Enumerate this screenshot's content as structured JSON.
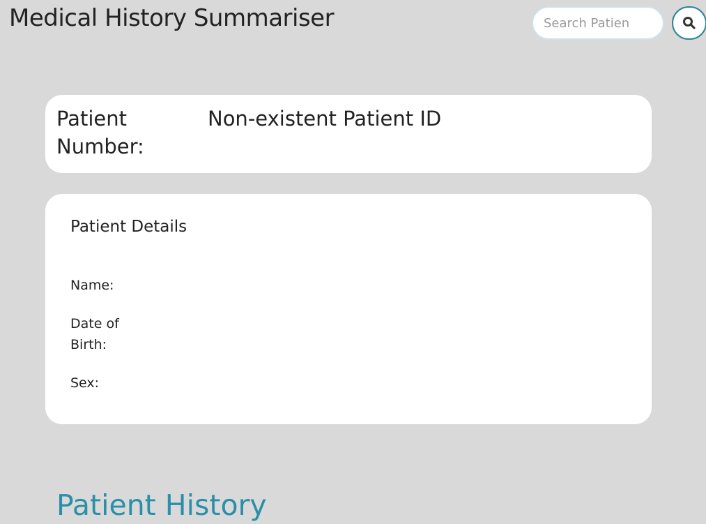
{
  "header": {
    "title": "Medical History Summariser",
    "search": {
      "placeholder": "Search Patien",
      "value": ""
    },
    "search_button_icon": "search-icon"
  },
  "patient_number_card": {
    "label": "Patient Number:",
    "value": "Non-existent Patient ID"
  },
  "patient_details": {
    "title": "Patient Details",
    "fields": [
      {
        "label": "Name:",
        "value": ""
      },
      {
        "label": "Date of Birth:",
        "value": ""
      },
      {
        "label": "Sex:",
        "value": ""
      }
    ]
  },
  "patient_history": {
    "title": "Patient History"
  },
  "colors": {
    "background": "#d9d9d9",
    "card": "#ffffff",
    "accent": "#2a8fa8",
    "text": "#222222"
  }
}
